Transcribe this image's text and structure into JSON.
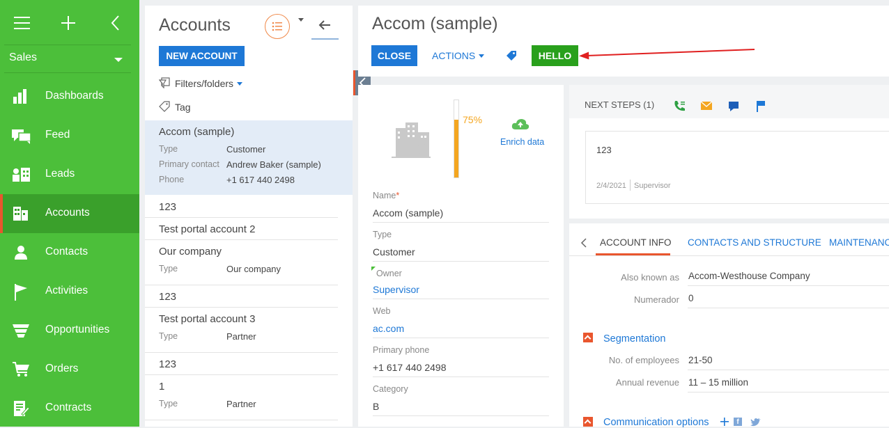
{
  "sidebar": {
    "workspace": "Sales",
    "items": [
      {
        "label": "Dashboards",
        "icon": "bar-chart-icon"
      },
      {
        "label": "Feed",
        "icon": "chat-bubbles-icon"
      },
      {
        "label": "Leads",
        "icon": "leads-icon"
      },
      {
        "label": "Accounts",
        "icon": "building-icon",
        "active": true
      },
      {
        "label": "Contacts",
        "icon": "person-icon"
      },
      {
        "label": "Activities",
        "icon": "flag-icon"
      },
      {
        "label": "Opportunities",
        "icon": "funnel-icon"
      },
      {
        "label": "Orders",
        "icon": "cart-icon"
      },
      {
        "label": "Contracts",
        "icon": "contract-icon"
      }
    ]
  },
  "list": {
    "title": "Accounts",
    "new_button": "NEW ACCOUNT",
    "filters_label": "Filters/folders",
    "tag_label": "Tag",
    "records": [
      {
        "name": "Accom (sample)",
        "fields": [
          {
            "key": "Type",
            "value": "Customer"
          },
          {
            "key": "Primary contact",
            "value": "Andrew Baker (sample)"
          },
          {
            "key": "Phone",
            "value": "+1 617 440 2498"
          }
        ]
      },
      {
        "name": "123"
      },
      {
        "name": "Test portal account 2"
      },
      {
        "name": "Our company",
        "fields": [
          {
            "key": "Type",
            "value": "Our company"
          }
        ]
      },
      {
        "name": "123"
      },
      {
        "name": "Test portal account 3",
        "fields": [
          {
            "key": "Type",
            "value": "Partner"
          }
        ]
      },
      {
        "name": "123"
      },
      {
        "name": "1",
        "fields": [
          {
            "key": "Type",
            "value": "Partner"
          }
        ]
      }
    ]
  },
  "header": {
    "title": "Accom (sample)",
    "close_button": "CLOSE",
    "actions_button": "ACTIONS",
    "hello_button": "HELLO"
  },
  "profile": {
    "completeness": "75%",
    "completeness_value": 0.75,
    "enrich_label": "Enrich data",
    "fields": [
      {
        "label": "Name",
        "required": "*",
        "value": "Accom (sample)"
      },
      {
        "label": "Type",
        "value": "Customer"
      },
      {
        "label": "Owner",
        "value": "Supervisor"
      },
      {
        "label": "Web",
        "value": "ac.com"
      },
      {
        "label": "Primary phone",
        "value": "+1 617 440 2498"
      },
      {
        "label": "Category",
        "value": "B"
      }
    ]
  },
  "next_steps": {
    "title": "NEXT STEPS (1)",
    "card_text": "123",
    "card_date": "2/4/2021",
    "card_author": "Supervisor"
  },
  "tabs": {
    "items": [
      "ACCOUNT INFO",
      "CONTACTS AND STRUCTURE",
      "MAINTENANCE"
    ],
    "fields": [
      {
        "label": "Also known as",
        "value": "Accom-Westhouse Company"
      },
      {
        "label": "Numerador",
        "value": "0"
      }
    ],
    "segmentation_title": "Segmentation",
    "segmentation_fields": [
      {
        "label": "No. of employees",
        "value": "21-50"
      },
      {
        "label": "Annual revenue",
        "value": "11 – 15 million"
      }
    ],
    "communication_title": "Communication options"
  },
  "colors": {
    "sidebar": "#4cbf3a",
    "primary_blue": "#1e78d6",
    "hello_green": "#29a01c",
    "accent_orange": "#e9562e",
    "annotation_red": "#e02020"
  }
}
